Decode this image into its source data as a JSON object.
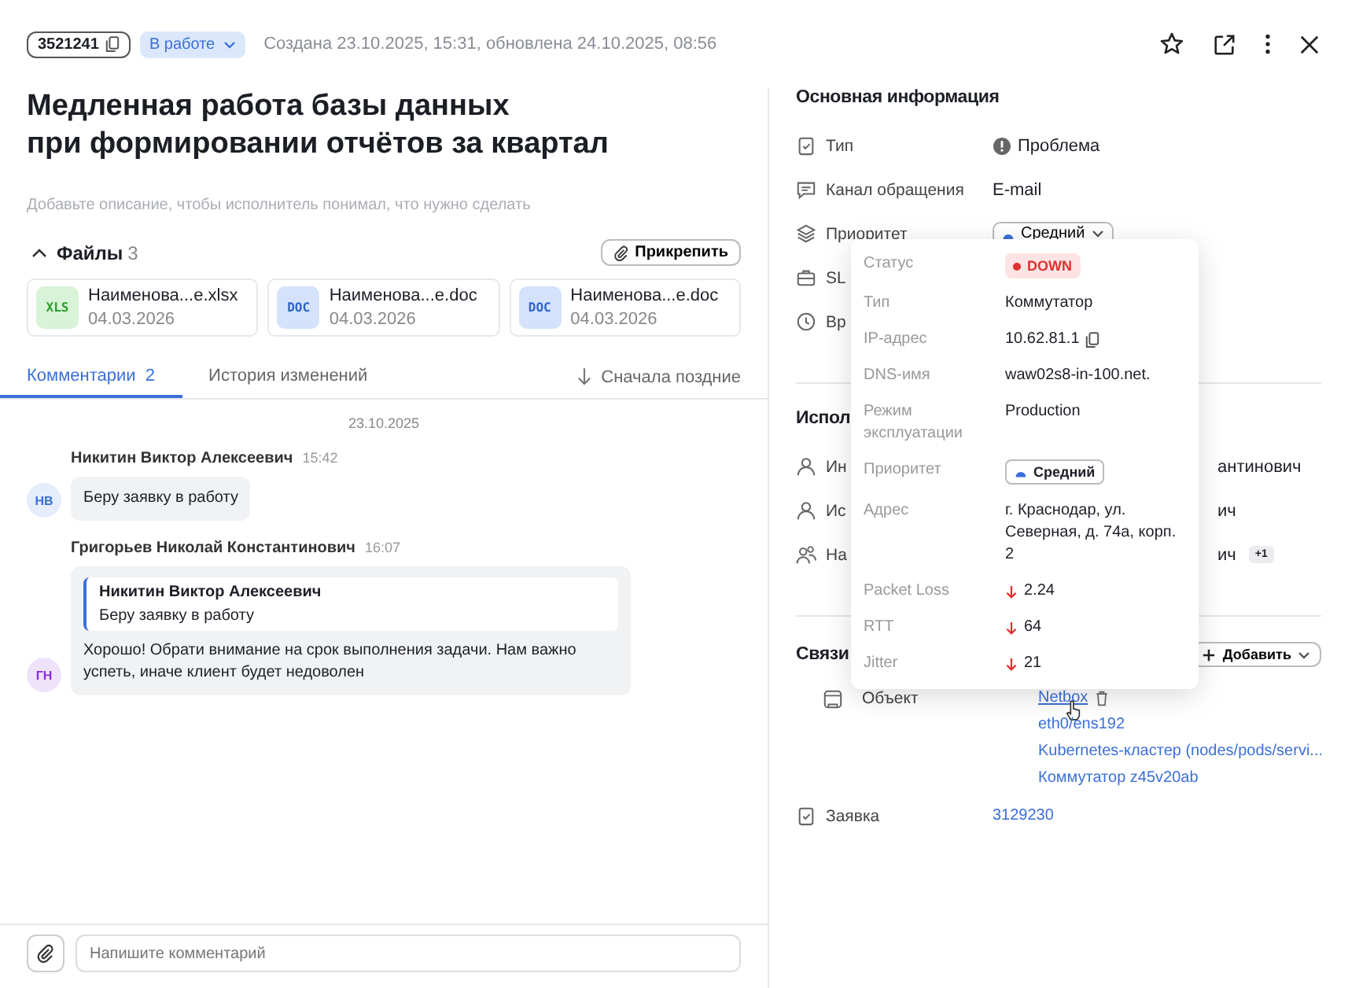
{
  "header": {
    "id": "3521241",
    "status": "В работе",
    "meta": "Создана 23.10.2025, 15:31, обновлена 24.10.2025, 08:56"
  },
  "title": "Медленная работа базы данных\nпри формировании отчётов за квартал",
  "description_placeholder": "Добавьте описание, чтобы исполнитель понимал, что нужно сделать",
  "files": {
    "label": "Файлы",
    "count": "3",
    "expanded": true,
    "attach": "Прикрепить",
    "items": [
      {
        "kind": "xls",
        "badge": "XLS",
        "name": "Наименова...e.xlsx",
        "date": "04.03.2026"
      },
      {
        "kind": "doc",
        "badge": "DOC",
        "name": "Наименова...e.doc",
        "date": "04.03.2026"
      },
      {
        "kind": "doc",
        "badge": "DOC",
        "name": "Наименова...e.doc",
        "date": "04.03.2026"
      }
    ]
  },
  "tabs": [
    {
      "label": "Комментарии",
      "count": "2",
      "selected": true
    },
    {
      "label": "История изменений",
      "selected": false
    }
  ],
  "sort": "Сначала поздние",
  "comments": {
    "date": "23.10.2025",
    "messages": [
      {
        "initials": "НВ",
        "color": "#3b6fd8",
        "author": "Никитин Виктор Алексеевич",
        "time": "15:42",
        "text": "Беру заявку в работу"
      },
      {
        "initials": "ГН",
        "color": "#8a2be2",
        "author": "Григорьев Николай Константинович",
        "time": "16:07",
        "quote": {
          "author": "Никитин Виктор Алексеевич",
          "text": "Беру заявку в работу"
        },
        "text": "Хорошо! Обрати внимание на срок выполнения задачи. Нам важно успеть, иначе клиент будет недоволен"
      }
    ]
  },
  "composer": {
    "placeholder": "Напишите комментарий"
  },
  "main_info": {
    "title": "Основная информация",
    "rows": [
      {
        "label": "Тип",
        "kind": "type",
        "value": "Проблема"
      },
      {
        "label": "Канал обращения",
        "kind": "text",
        "value": "E-mail"
      },
      {
        "label": "Приоритет",
        "kind": "dropdown",
        "value": "Средний"
      },
      {
        "label": "SL",
        "kind": "empty"
      },
      {
        "label": "Вр",
        "kind": "empty"
      }
    ]
  },
  "assignees": {
    "title": "Испол",
    "rows": [
      {
        "label": "Ин",
        "value": "антинович"
      },
      {
        "label": "Ис",
        "value": "ич"
      },
      {
        "label": "На",
        "value": "ич",
        "extra": "+1"
      }
    ]
  },
  "relations": {
    "title": "Связи",
    "add": "Добавить",
    "object_label": "Объект",
    "links": [
      "Netbox",
      "eth0/ens192",
      "Kubernetes-кластер (nodes/pods/servi...",
      "Коммутатор z45v20ab"
    ],
    "request_label": "Заявка",
    "request": "3129230"
  },
  "popup": {
    "rows": [
      {
        "label": "Статус",
        "kind": "status",
        "value": "DOWN"
      },
      {
        "label": "Тип",
        "kind": "text",
        "value": "Коммутатор"
      },
      {
        "label": "IP-адрес",
        "kind": "copy",
        "value": "10.62.81.1"
      },
      {
        "label": "DNS-имя",
        "kind": "text",
        "value": "waw02s8-in-100.net."
      },
      {
        "label": "Режим эксплуатации",
        "kind": "text",
        "value": "Production"
      },
      {
        "label": "Приоритет",
        "kind": "priority",
        "value": "Средний"
      },
      {
        "label": "Адрес",
        "kind": "text",
        "value": "г. Краснодар, ул. Северная, д. 74а, корп. 2"
      },
      {
        "label": "Packet Loss",
        "kind": "metric",
        "value": "2.24"
      },
      {
        "label": "RTT",
        "kind": "metric",
        "value": "64"
      },
      {
        "label": "Jitter",
        "kind": "metric",
        "value": "21"
      }
    ]
  }
}
